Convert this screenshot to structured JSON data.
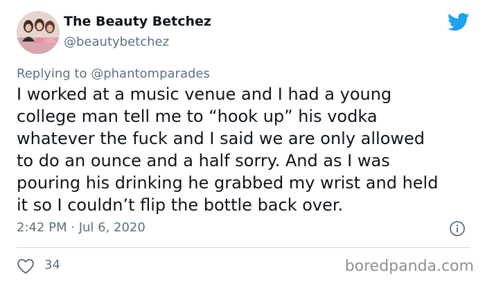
{
  "author": {
    "display_name": "The Beauty Betchez",
    "handle": "@beautybetchez",
    "avatar_icon": "profile-photo"
  },
  "reply": {
    "prefix": "Replying to",
    "mention": "@phantomparades"
  },
  "tweet": {
    "lines": [
      "I worked at a music venue and I had a young",
      "college man tell me to “hook up” his vodka",
      "whatever the fuck and I said we are only allowed",
      "to do an ounce and a half sorry. And as I was",
      "pouring his drinking he grabbed my wrist and held",
      "it so I couldn’t flip the bottle back over."
    ],
    "timestamp": "2:42 PM · Jul 6, 2020"
  },
  "actions": {
    "like_icon": "heart-icon",
    "like_count": "34",
    "info_icon": "info-icon"
  },
  "brand": {
    "twitter_icon": "twitter-bird-icon",
    "twitter_color": "#1da1f2",
    "watermark": "boredpanda.com"
  },
  "colors": {
    "text_primary": "#0f1419",
    "text_secondary": "#5b7083",
    "divider": "#cfd9de"
  }
}
